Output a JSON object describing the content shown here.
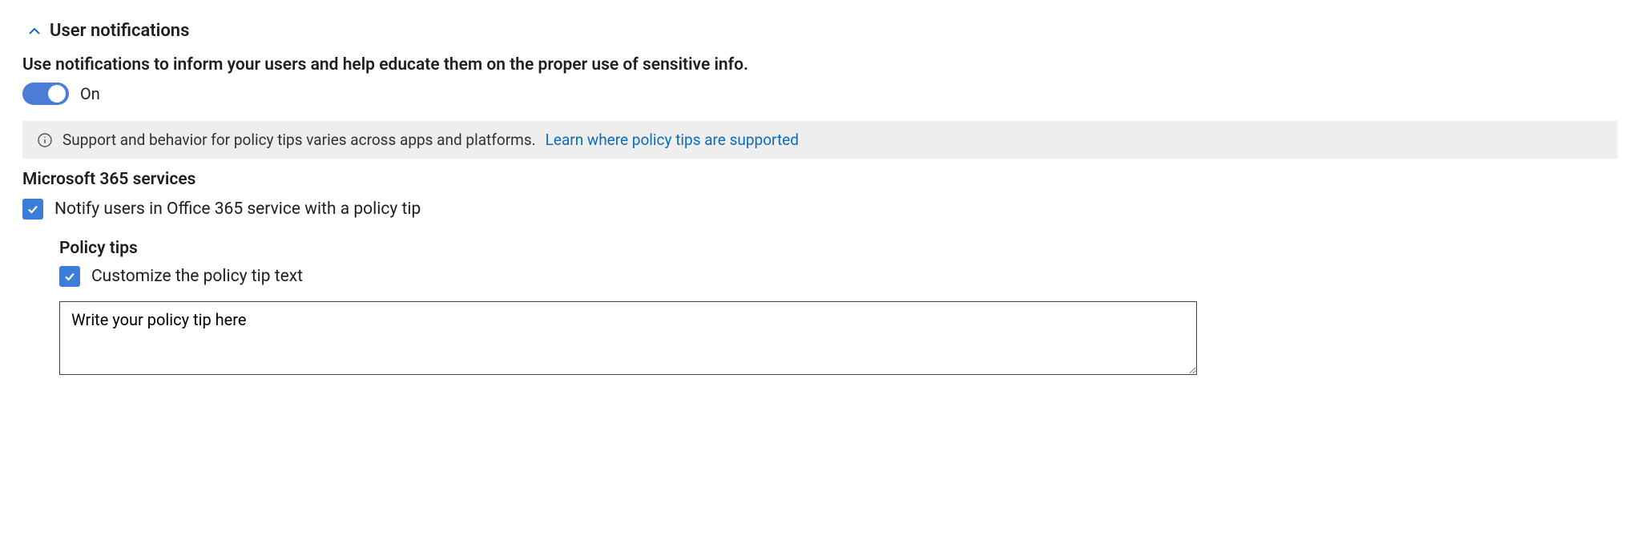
{
  "section": {
    "title": "User notifications",
    "description": "Use notifications to inform your users and help educate them on the proper use of sensitive info."
  },
  "toggle": {
    "label": "On",
    "state": "on"
  },
  "info": {
    "text": "Support and behavior for policy tips varies across apps and platforms.",
    "link_label": "Learn where policy tips are supported"
  },
  "services": {
    "heading": "Microsoft 365 services",
    "notify_checkbox_label": "Notify users in Office 365 service with a policy tip"
  },
  "policy_tips": {
    "heading": "Policy tips",
    "customize_checkbox_label": "Customize the policy tip text",
    "textarea_value": "Write your policy tip here"
  }
}
